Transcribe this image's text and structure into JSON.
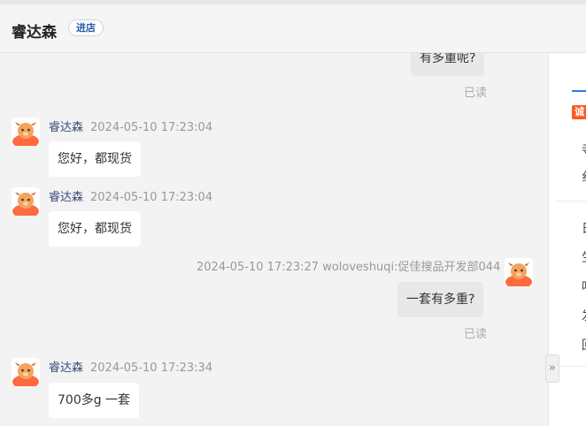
{
  "header": {
    "shop_name": "睿达森",
    "enter_shop_label": "进店"
  },
  "messages": [
    {
      "type": "mine",
      "text": "有多重呢?",
      "read_status": "已读"
    },
    {
      "type": "theirs",
      "sender": "睿达森",
      "time": "2024-05-10 17:23:04",
      "text": "您好，都现货"
    },
    {
      "type": "theirs",
      "sender": "睿达森",
      "time": "2024-05-10 17:23:04",
      "text": "您好，都现货"
    },
    {
      "type": "mine",
      "meta": "2024-05-10 17:23:27  woloveshuqi:促佳搜品开发部044",
      "text": "一套有多重?",
      "read_status": "已读"
    },
    {
      "type": "theirs",
      "sender": "睿达森",
      "time": "2024-05-10 17:23:34",
      "text": "700多g 一套"
    }
  ],
  "side_panel": {
    "badge": "诚",
    "cut_chars": [
      "寺",
      "纟",
      "日",
      "生",
      "吋",
      "发",
      "回"
    ]
  },
  "icons": {
    "avatar": "cartoon-avatar-icon",
    "collapse": "double-chevron-right-icon"
  },
  "colors": {
    "accent": "#2d7be5",
    "badge": "#ff5a1f",
    "name": "#3a4a7a"
  }
}
